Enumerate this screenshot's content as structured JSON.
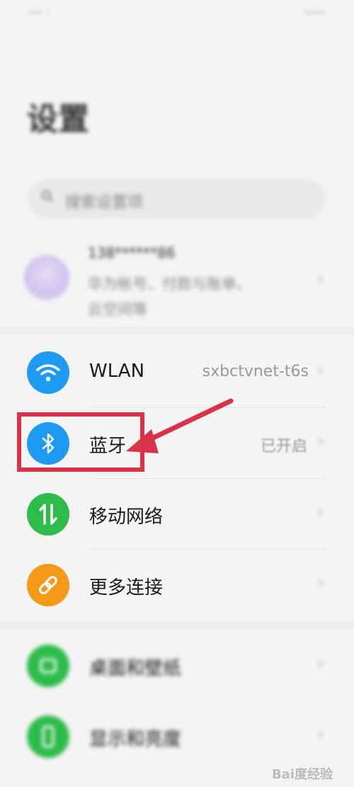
{
  "status_bar": {
    "left": "···· ·",
    "right": "······"
  },
  "page_title": "设置",
  "search": {
    "placeholder": "搜索设置项",
    "icon": "search-icon"
  },
  "account": {
    "name": "138******86",
    "subtitle_line1": "华为帐号、付款与账单、",
    "subtitle_line2": "云空间等"
  },
  "rows": [
    {
      "label": "WLAN",
      "value": "sxbctvnet-t6s",
      "icon": "wifi-icon",
      "color": "#1e9bf0"
    },
    {
      "label": "蓝牙",
      "value": "已开启",
      "icon": "bluetooth-icon",
      "color": "#1e9bf0"
    },
    {
      "label": "移动网络",
      "value": "",
      "icon": "mobile-data-icon",
      "color": "#2dbb4a"
    },
    {
      "label": "更多连接",
      "value": "",
      "icon": "link-icon",
      "color": "#f49a18"
    },
    {
      "label": "桌面和壁纸",
      "value": "",
      "icon": "wallpaper-icon",
      "color": "#2dbb4a"
    },
    {
      "label": "显示和亮度",
      "value": "",
      "icon": "display-icon",
      "color": "#2dbb4a"
    }
  ],
  "chevron": "›",
  "watermark": "Bai度经验",
  "annotation": {
    "color": "#d9334a"
  }
}
